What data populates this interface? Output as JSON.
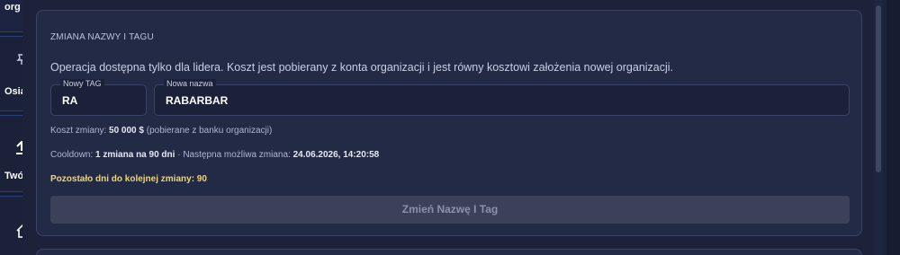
{
  "sidebar": {
    "items": [
      {
        "label": "org",
        "icon": "org-icon"
      },
      {
        "label": "Osia",
        "icon": "pin-icon"
      },
      {
        "label": "Twó",
        "icon": "upload-icon"
      },
      {
        "label": "",
        "icon": "home-icon"
      }
    ]
  },
  "section": {
    "title": "ZMIANA NAZWY I TAGU",
    "description": "Operacja dostępna tylko dla lidera. Koszt jest pobierany z konta organizacji i jest równy kosztowi założenia nowej organizacji."
  },
  "form": {
    "tag_label": "Nowy TAG",
    "tag_value": "RA",
    "name_label": "Nowa nazwa",
    "name_value": "RABARBAR"
  },
  "cost": {
    "prefix": "Koszt zmiany:",
    "amount": "50 000 $",
    "suffix": "(pobierane z banku organizacji)"
  },
  "cooldown": {
    "prefix": "Cooldown:",
    "value": "1 zmiana na 90 dni",
    "separator": "·",
    "next_prefix": "Następna możliwa zmiana:",
    "next_value": "24.06.2026, 14:20:58"
  },
  "remaining": {
    "text": "Pozostało dni do kolejnej zmiany: 90"
  },
  "submit_button": {
    "label": "Zmień Nazwę I Tag",
    "disabled": true
  },
  "colors": {
    "accent_warning": "#f2d56b",
    "card_bg": "#222a45",
    "button_disabled": "#3a4159"
  }
}
